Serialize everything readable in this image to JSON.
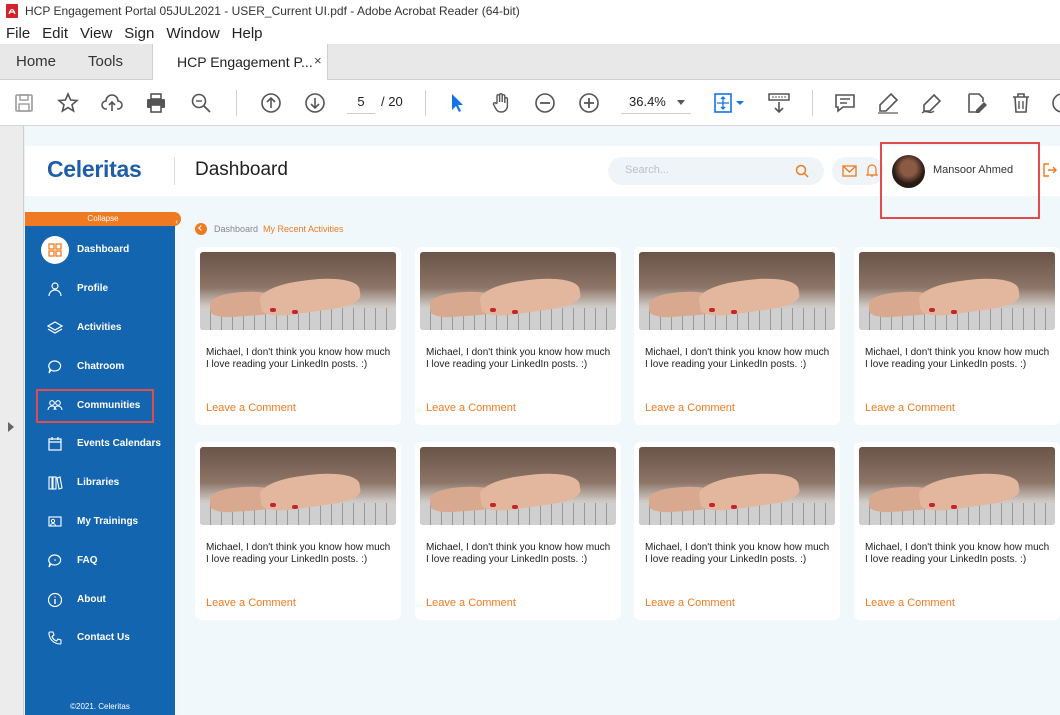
{
  "window": {
    "title": "HCP Engagement Portal 05JUL2021 - USER_Current UI.pdf - Adobe Acrobat Reader (64-bit)"
  },
  "menu": [
    "File",
    "Edit",
    "View",
    "Sign",
    "Window",
    "Help"
  ],
  "tabs": {
    "home": "Home",
    "tools": "Tools",
    "doc": "HCP Engagement P...",
    "close": "×"
  },
  "toolbar": {
    "page_current": "5",
    "page_total": "/ 20",
    "zoom": "36.4%"
  },
  "app": {
    "logo": "Celeritas",
    "page_title": "Dashboard",
    "search_placeholder": "Search...",
    "user_name": "Mansoor Ahmed"
  },
  "sidebar": {
    "collapse": "Collapse",
    "items": [
      {
        "label": "Dashboard",
        "icon": "dashboard-icon"
      },
      {
        "label": "Profile",
        "icon": "user-icon"
      },
      {
        "label": "Activities",
        "icon": "layers-icon"
      },
      {
        "label": "Chatroom",
        "icon": "chat-icon"
      },
      {
        "label": "Communities",
        "icon": "users-icon"
      },
      {
        "label": "Events Calendars",
        "icon": "calendar-icon"
      },
      {
        "label": "Libraries",
        "icon": "library-icon"
      },
      {
        "label": "My Trainings",
        "icon": "training-icon"
      },
      {
        "label": "FAQ",
        "icon": "faq-icon"
      },
      {
        "label": "About",
        "icon": "info-icon"
      },
      {
        "label": "Contact Us",
        "icon": "phone-icon"
      }
    ],
    "footer": "©2021. Celeritas"
  },
  "breadcrumb": {
    "root": "Dashboard",
    "current": "My Recent Activities"
  },
  "cards": [
    {
      "text": "Michael, I don't think you know how much I love reading your LinkedIn posts. :)",
      "action": "Leave a Comment"
    },
    {
      "text": "Michael, I don't think you know how much I love reading your LinkedIn posts. :)",
      "action": "Leave a Comment"
    },
    {
      "text": "Michael, I don't think you know how much I love reading your LinkedIn posts. :)",
      "action": "Leave a Comment"
    },
    {
      "text": "Michael, I don't think you know how much I love reading your LinkedIn posts. :)",
      "action": "Leave a Comment"
    },
    {
      "text": "Michael, I don't think you know how much I love reading your LinkedIn posts. :)",
      "action": "Leave a Comment"
    },
    {
      "text": "Michael, I don't think you know how much I love reading your LinkedIn posts. :)",
      "action": "Leave a Comment"
    },
    {
      "text": "Michael, I don't think you know how much I love reading your LinkedIn posts. :)",
      "action": "Leave a Comment"
    },
    {
      "text": "Michael, I don't think you know how much I love reading your LinkedIn posts. :)",
      "action": "Leave a Comment"
    }
  ],
  "colors": {
    "brand_blue": "#1465b0",
    "accent_orange": "#f07a21",
    "highlight_red": "#e14b4b"
  }
}
